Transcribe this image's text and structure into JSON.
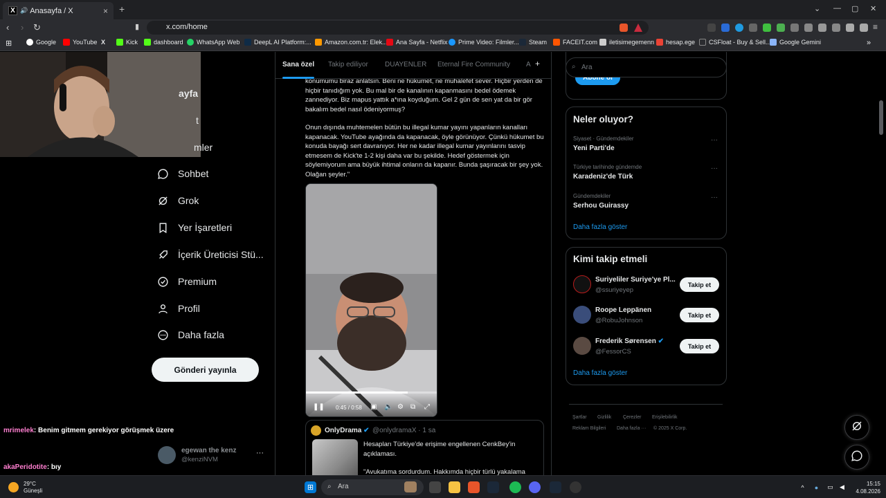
{
  "browser": {
    "tab_title": "Anasayfa / X",
    "tab_close": "×",
    "new_tab": "+",
    "url": "x.com/home",
    "bookmarks": [
      "Google",
      "YouTube",
      "Kick",
      "dashboard",
      "WhatsApp Web",
      "DeepL AI Platform:...",
      "Amazon.com.tr: Elek...",
      "Ana Sayfa - Netflix",
      "Prime Video: Filmler...",
      "Steam",
      "FACEIT.com",
      "iletisimegemenn",
      "hesap.ege",
      "CSFloat - Buy & Sell...",
      "Google Gemini"
    ]
  },
  "sidebar": {
    "partial_items": [
      "ayfa",
      "t",
      "mler"
    ],
    "items": [
      {
        "label": "Sohbet",
        "icon": "chat-bubble-icon"
      },
      {
        "label": "Grok",
        "icon": "grok-icon"
      },
      {
        "label": "Yer İşaretleri",
        "icon": "bookmark-icon"
      },
      {
        "label": "İçerik Üreticisi Stü...",
        "icon": "rocket-icon"
      },
      {
        "label": "Premium",
        "icon": "verified-badge-icon"
      },
      {
        "label": "Profil",
        "icon": "person-icon"
      },
      {
        "label": "Daha fazla",
        "icon": "more-circle-icon"
      }
    ],
    "post_button": "Gönderi yayınla",
    "account": {
      "name": "egewan the kenz",
      "handle": "@kenziNVM",
      "more": "···"
    }
  },
  "chat": {
    "lines": [
      {
        "user": "mrimelek",
        "message": ": Benim gitmem gerekiyor görüşmek üzere",
        "color": "#ff7fd0"
      },
      {
        "user": "akaPeridotite",
        "message": ": bıy",
        "color": "#ff7fd0"
      }
    ]
  },
  "feed": {
    "tabs": [
      "Sana özel",
      "Takip ediliyor",
      "DUAYENLER",
      "Eternal Fire Community",
      "A"
    ],
    "add_tab": "+",
    "tweet_paragraphs": [
      "konumumu biraz anlatsın. Beni ne hükumet, ne muhalefet sever. Hiçbir yerden de hiçbir tanıdığım yok. Bu mal bir de kanalının kapanmasını bedel ödemek zannediyor. Biz mapus yattık a*ına koyduğum. Gel 2 gün de sen yat da bir gör bakalım bedel nasıl ödeniyormuş?",
      "Onun dışında muhtemelen bütün bu illegal kumar yayını yapanların kanalları kapanacak. YouTube ayağında da kapanacak, öyle görünüyor. Çünkü hükumet bu konuda bayağı sert davranıyor. Her ne kadar illegal kumar yayınlarını tasvip etmesem de Kick'te 1-2 kişi daha var bu şekilde. Hedef göstermek için söylemiyorum ama büyük ihtimal onların da kapanır. Bunda şaşıracak bir şey yok. Olağan şeyler.\""
    ],
    "video": {
      "time": "0:45 / 0:58",
      "progress": 0.776
    },
    "quote": {
      "name": "OnlyDrama",
      "handle": "@onlydramaX · 1 sa",
      "text_1": "Hesapları Türkiye'de erişime engellenen CenkBey'in açıklaması.",
      "text_2": "\"Avukatıma sordurdum. Hakkımda hiçbir türlü yakalama"
    }
  },
  "right": {
    "search_placeholder": "Ara",
    "subscribe": "Abone ol",
    "trends_title": "Neler oluyor?",
    "trends": [
      {
        "category": "Siyaset · Gündemdekiler",
        "name": "Yeni Parti'de"
      },
      {
        "category": "Türkiye tarihinde gündemde",
        "name": "Karadeniz'de Türk"
      },
      {
        "category": "Gündemdekiler",
        "name": "Serhou Guirassy"
      }
    ],
    "show_more": "Daha fazla göster",
    "who_to_follow_title": "Kimi takip etmeli",
    "who_to_follow": [
      {
        "name": "Suriyeliler Suriye'ye Pl...",
        "handle": "@ssuriyeyep",
        "avatar_color": "#b81c1c"
      },
      {
        "name": "Roope Leppänen",
        "handle": "@RobuJohnson",
        "avatar_color": "#3a4d7a"
      },
      {
        "name": "Frederik Sørensen",
        "handle": "@FessorCS",
        "avatar_color": "#5a4a42"
      }
    ],
    "follow_label": "Takip et",
    "footer": [
      "Şartlar",
      "Gizlilik",
      "Çerezler",
      "Erişilebilirlik",
      "Reklam Bilgileri",
      "Daha fazla ···",
      "© 2025 X Corp."
    ]
  },
  "taskbar": {
    "temp": "29°C",
    "weather": "Güneşli",
    "search": "Ara",
    "time": "15:15",
    "date": "4.08.2026"
  }
}
